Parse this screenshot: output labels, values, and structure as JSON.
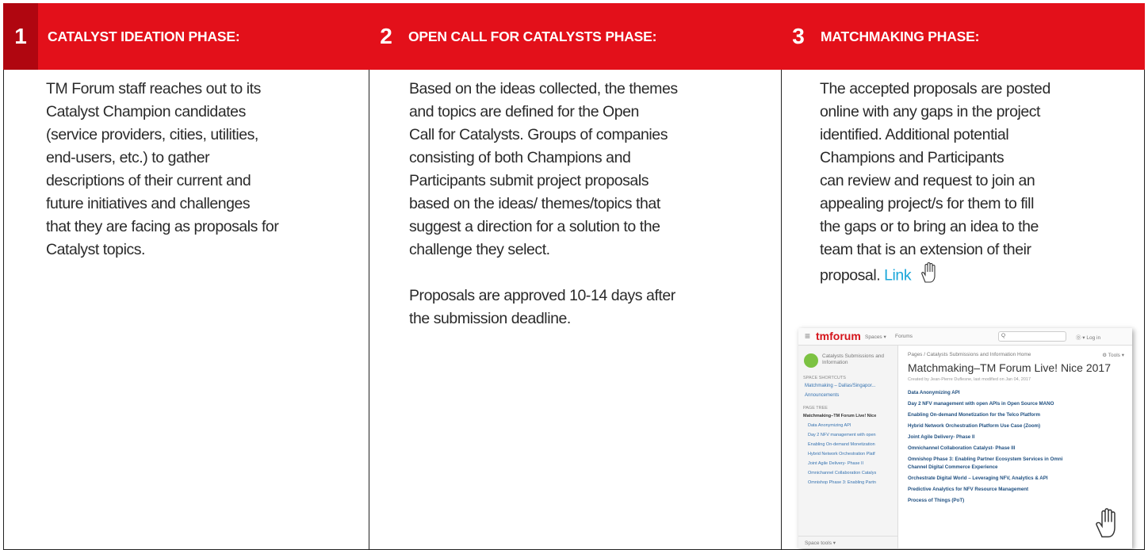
{
  "phases": [
    {
      "number": "1",
      "title": "CATALYST IDEATION PHASE:",
      "lines": [
        "TM Forum staff reaches out to its",
        "Catalyst Champion candidates",
        "(service providers, cities, utilities,",
        "end-users, etc.) to gather",
        "descriptions of their current and",
        "future initiatives and challenges",
        "that they are facing as proposals for",
        "Catalyst topics."
      ]
    },
    {
      "number": "2",
      "title": "OPEN CALL FOR CATALYSTS PHASE:",
      "lines": [
        "Based on the ideas collected, the themes",
        "and topics are defined for the Open",
        "Call for Catalysts. Groups of companies",
        "consisting of both Champions and",
        "Participants submit project proposals",
        "based on the ideas/ themes/topics that",
        "suggest a direction for a solution to the",
        "challenge they select."
      ],
      "lines2": [
        "Proposals are approved 10-14 days after",
        "the submission deadline."
      ]
    },
    {
      "number": "3",
      "title": "MATCHMAKING PHASE:",
      "lines": [
        "The accepted proposals are posted",
        "online with any gaps in the project",
        "identified.  Additional potential",
        "Champions and Participants",
        "can review and request to join an",
        "appealing project/s for them to fill",
        "the gaps or to bring an idea to the",
        "team that is an extension of their"
      ],
      "last_line_prefix": "proposal. ",
      "link_label": "Link"
    }
  ],
  "screenshot": {
    "logo": "tmforum",
    "nav": [
      "Spaces ▾",
      "Forums"
    ],
    "search_placeholder": "Q",
    "right": "⓪ ▾   Log in",
    "space_name": "Catalysts Submissions and Information",
    "space_shortcuts_label": "SPACE SHORTCUTS",
    "shortcuts": [
      "Matchmaking – Dallas/Singapor...",
      "Announcements"
    ],
    "page_tree_label": "PAGE TREE",
    "tree": [
      "Matchmaking–TM Forum Live! Nice",
      "Data Anonymizing API",
      "Day 2 NFV management with open",
      "Enabling On-demand Monetization",
      "Hybrid Network Orchestration Platf",
      "Joint Agile Delivery- Phase II",
      "Omnichannel Collaboration Catalys",
      "Omnishop Phase 3: Enabling Partn"
    ],
    "space_tools": "Space tools ▾",
    "breadcrumb": "Pages  /  Catalysts Submissions and Information Home",
    "tools": "⚙ Tools ▾",
    "page_title": "Matchmaking–TM Forum Live! Nice 2017",
    "meta": "Created by Jean-Pierre Duflesne, last modified on Jan 04, 2017",
    "links": [
      "Data Anonymizing API",
      "Day 2 NFV management with open APIs in Open Source MANO",
      "Enabling On-demand Monetization for the Telco Platform",
      "Hybrid Network Orchestration Platform Use Case (Zoom)",
      "Joint Agile Delivery- Phase II",
      "Omnichannel Collaboration Catalyst- Phase III",
      "Omnishop Phase 3: Enabling Partner Ecosystem Services in Omni",
      "Channel Digital Commerce Experience",
      "Orchestrate Digital World – Leveraging NFV, Analytics & API",
      "Predictive Analytics for NFV Resource Management",
      "Process of Things (PoT)"
    ]
  }
}
